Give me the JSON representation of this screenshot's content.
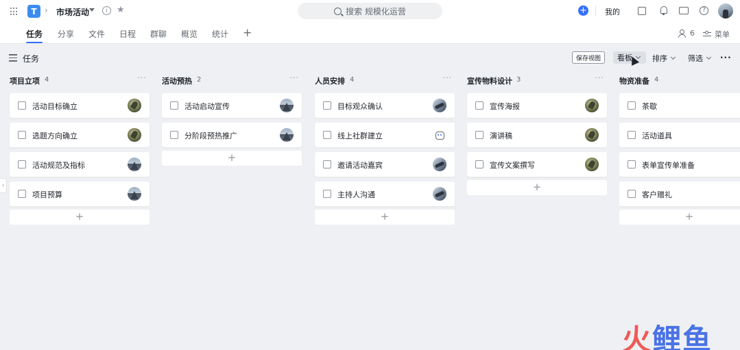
{
  "header": {
    "project_title": "市场活动",
    "search_placeholder": "搜索 规模化运营",
    "mine_label": "我的"
  },
  "tabs": [
    {
      "label": "任务",
      "active": true
    },
    {
      "label": "分享",
      "active": false
    },
    {
      "label": "文件",
      "active": false
    },
    {
      "label": "日程",
      "active": false
    },
    {
      "label": "群聊",
      "active": false
    },
    {
      "label": "概览",
      "active": false
    },
    {
      "label": "统计",
      "active": false
    }
  ],
  "members_count": "6",
  "menu_label": "菜单",
  "toolbar": {
    "title": "任务",
    "save_view": "保存视图",
    "view_mode": "看板",
    "sort": "排序",
    "filter": "筛选"
  },
  "columns": [
    {
      "name": "项目立项",
      "count": "4",
      "cards": [
        {
          "title": "活动目标确立",
          "avatar": "nature"
        },
        {
          "title": "选题方向确立",
          "avatar": "nature"
        },
        {
          "title": "活动规范及指标",
          "avatar": "mountain"
        },
        {
          "title": "项目预算",
          "avatar": "mountain"
        }
      ]
    },
    {
      "name": "活动预热",
      "count": "2",
      "cards": [
        {
          "title": "活动启动宣传",
          "avatar": "mountain"
        },
        {
          "title": "分阶段预热推广",
          "avatar": "mountain"
        }
      ]
    },
    {
      "name": "人员安排",
      "count": "4",
      "cards": [
        {
          "title": "目标观众确认",
          "avatar": "swirl"
        },
        {
          "title": "线上社群建立",
          "avatar": "robot"
        },
        {
          "title": "邀请活动嘉宾",
          "avatar": "swirl"
        },
        {
          "title": "主持人沟通",
          "avatar": "swirl"
        }
      ]
    },
    {
      "name": "宣传物料设计",
      "count": "3",
      "cards": [
        {
          "title": "宣传海报",
          "avatar": "nature"
        },
        {
          "title": "演讲稿",
          "avatar": "nature"
        },
        {
          "title": "宣传文案撰写",
          "avatar": "nature"
        }
      ]
    },
    {
      "name": "物资准备",
      "count": "4",
      "cards": [
        {
          "title": "茶歇",
          "avatar": ""
        },
        {
          "title": "活动道具",
          "avatar": ""
        },
        {
          "title": "表单宣传单准备",
          "avatar": ""
        },
        {
          "title": "客户赠礼",
          "avatar": ""
        }
      ]
    }
  ],
  "watermark": "火鲤鱼",
  "colors": {
    "accent": "#3370ff",
    "logo": "#3c8cf0",
    "brand_red": "#ee5a55",
    "brand_blue": "#4a72e6"
  }
}
